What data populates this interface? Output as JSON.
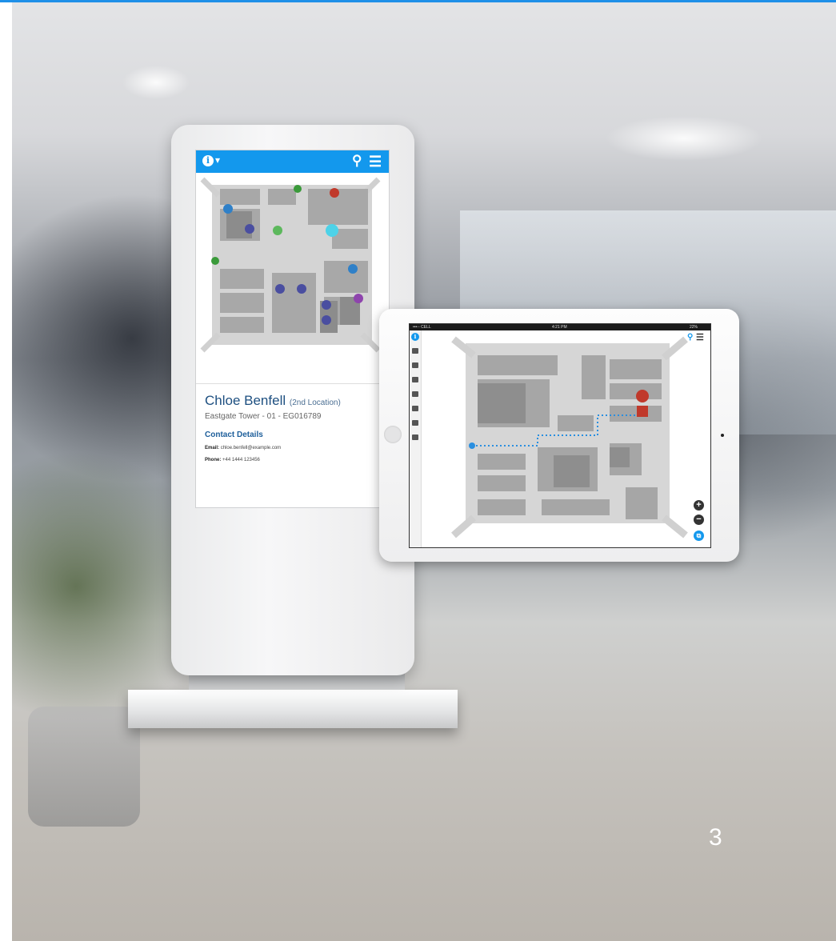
{
  "page": {
    "number": "3"
  },
  "kiosk": {
    "header": {
      "info_icon": "info-circle-icon",
      "caret_icon": "caret-down-icon",
      "search_icon": "search-icon",
      "menu_icon": "hamburger-menu-icon"
    },
    "person": {
      "name": "Chloe Benfell",
      "name_suffix": "(2nd Location)",
      "address": "Eastgate Tower - 01 - EG016789",
      "contact_heading": "Contact Details",
      "email_label": "Email:",
      "email": "chloe.benfell@example.com",
      "phone_label": "Phone:",
      "phone": "+44 1444 123456"
    },
    "map_markers": [
      {
        "icon": "restroom-icon",
        "color": "#2f80c8"
      },
      {
        "icon": "exit-icon",
        "color": "#3a9a3a"
      },
      {
        "icon": "first-aid-icon",
        "color": "#c0392b"
      },
      {
        "icon": "meeting-room-icon",
        "color": "#4a4ea0"
      },
      {
        "icon": "meeting-room-icon",
        "color": "#5cb85c"
      },
      {
        "icon": "destination-star-icon",
        "color": "#4dd2e8"
      },
      {
        "icon": "restroom-icon",
        "color": "#2f80c8"
      },
      {
        "icon": "meeting-room-icon",
        "color": "#4a4ea0"
      },
      {
        "icon": "meeting-room-icon",
        "color": "#4a4ea0"
      },
      {
        "icon": "meeting-room-icon",
        "color": "#4a4ea0"
      },
      {
        "icon": "meeting-room-icon",
        "color": "#4a4ea0"
      },
      {
        "icon": "accessibility-icon",
        "color": "#8e44ad"
      },
      {
        "icon": "exit-icon",
        "color": "#3a9a3a"
      }
    ]
  },
  "tablet": {
    "status": {
      "carrier": "•••◦◦ CELL",
      "time": "4:21 PM",
      "battery": "22%"
    },
    "sidebar_icons": [
      "info-icon",
      "exit-icon",
      "restroom-icon",
      "meeting-room-icon",
      "wifi-icon",
      "toilet-icon",
      "accessibility-icon",
      "checklist-icon"
    ],
    "controls": {
      "zoom_in": "+",
      "zoom_out": "−",
      "layers": "⧉"
    },
    "destination_marker": {
      "icon": "destination-star-icon",
      "color": "#c0392b"
    },
    "route_color": "#2a8fe0"
  },
  "colors": {
    "accent": "#1398ed",
    "name": "#1d4f80"
  }
}
